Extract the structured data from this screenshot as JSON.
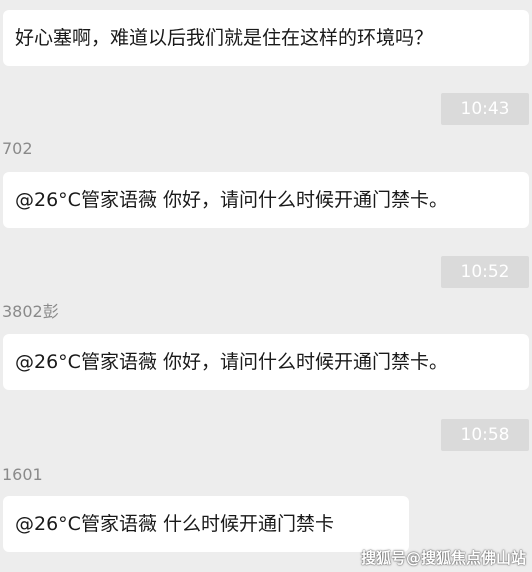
{
  "messages": [
    {
      "type": "text",
      "text": "好心塞啊，难道以后我们就是住在这样的环境吗？"
    },
    {
      "type": "time",
      "text": "10:43"
    },
    {
      "type": "sender",
      "text": "702"
    },
    {
      "type": "text",
      "text": "@26°C管家语薇 你好，请问什么时候开通门禁卡。"
    },
    {
      "type": "time",
      "text": "10:52"
    },
    {
      "type": "sender",
      "text": "3802彭"
    },
    {
      "type": "text",
      "text": "@26°C管家语薇 你好，请问什么时候开通门禁卡。"
    },
    {
      "type": "time",
      "text": "10:58"
    },
    {
      "type": "sender",
      "text": "1601"
    },
    {
      "type": "text",
      "text": "@26°C管家语薇 什么时候开通门禁卡"
    }
  ],
  "watermark": "搜狐号@搜狐焦点佛山站"
}
